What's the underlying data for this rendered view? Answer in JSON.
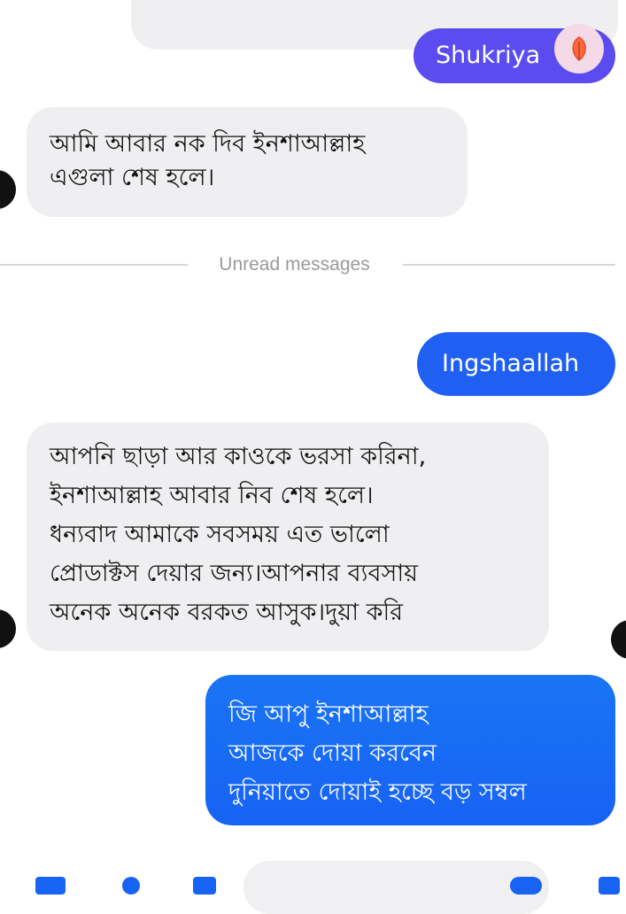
{
  "conversation": {
    "divider_label": "Unread messages",
    "messages": [
      {
        "sender": "me",
        "text": "Shukriya"
      },
      {
        "sender": "them",
        "lines": [
          "আমি আবার নক দিব ইনশাআল্লাহ",
          "এগুলা শেষ হলে।"
        ]
      },
      {
        "sender": "me",
        "text": "Ingshaallah"
      },
      {
        "sender": "them",
        "lines": [
          "আপনি ছাড়া আর কাওকে ভরসা করিনা,",
          "ইনশাআল্লাহ আবার নিব শেষ হলে।",
          "ধন্যবাদ আমাকে সবসময় এত ভালো",
          "প্রোডাক্টস দেয়ার জন্য।আপনার ব্যবসায়",
          "অনেক অনেক বরকত আসুক।দুয়া করি"
        ]
      },
      {
        "sender": "me",
        "lines": [
          "জি আপু ইনশাআল্লাহ",
          "আজকে দোয়া করবেন",
          "দুনিয়াতে দোয়াই হচ্ছে বড় সম্বল"
        ]
      }
    ]
  },
  "colors": {
    "incoming_bubble": "#efeff1",
    "outgoing_purple": "#5b4cf0",
    "outgoing_blue": "#1763f3",
    "reaction_bg": "#f4d9e6"
  },
  "icons": {
    "reaction": "leaf-reaction-icon",
    "avatar": "avatar-icon"
  }
}
